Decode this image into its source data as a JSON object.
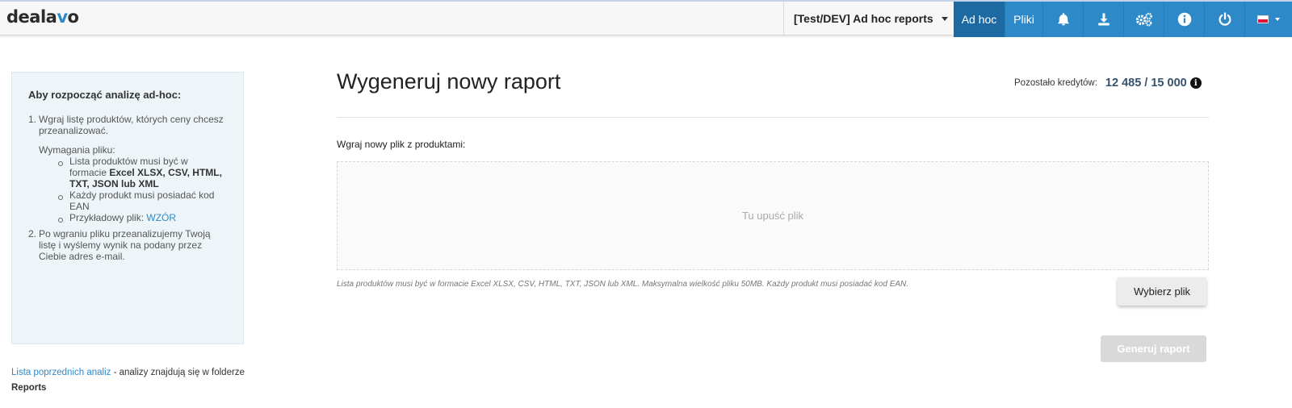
{
  "app": {
    "logo_left": "deala",
    "logo_v": "v",
    "logo_right": "o"
  },
  "header": {
    "project": "[Test/DEV] Ad hoc reports",
    "tabs": [
      {
        "label": "Ad hoc",
        "active": true
      },
      {
        "label": "Pliki",
        "active": false
      }
    ],
    "icons": [
      "bell-icon",
      "download-icon",
      "settings-icon",
      "info-icon",
      "power-icon"
    ],
    "language_flag": "pl-flag-icon",
    "accent_color": "#2e89c8"
  },
  "sidebar": {
    "heading": "Aby rozpocząć analizę ad-hoc:",
    "step1_num": "1.",
    "step1_text": "Wgraj listę produktów, których ceny chcesz przeanalizować.",
    "requirements_title": "Wymagania pliku:",
    "req1_text": "Lista produktów musi być w formacie",
    "req1_bold": "Excel XLSX, CSV, HTML, TXT, JSON lub XML",
    "req2_text": "Każdy produkt musi posiadać kod EAN",
    "req3_text": "Przykładowy plik:",
    "req3_link": "WZÓR",
    "step2_num": "2.",
    "step2_text": "Po wgraniu pliku przeanalizujemy Twoją listę i wyślemy wynik na podany przez Ciebie adres e-mail."
  },
  "footer_note": {
    "link": "Lista poprzednich analiz",
    "text": " - analizy znajdują się w folderze",
    "folder": "Reports"
  },
  "main": {
    "title": "Wygeneruj nowy raport",
    "credits_label": "Pozostało kredytów:",
    "credits_value": "12 485 / 15 000",
    "upload_label": "Wgraj nowy plik z produktami:",
    "drop_placeholder": "Tu upuść plik",
    "hint": "Lista produktów musi być w formacie Excel XLSX, CSV, HTML, TXT, JSON lub XML. Maksymalna wielkość pliku 50MB. Każdy produkt musi posiadać kod EAN.",
    "choose_button": "Wybierz plik",
    "generate_button": "Generuj raport"
  }
}
